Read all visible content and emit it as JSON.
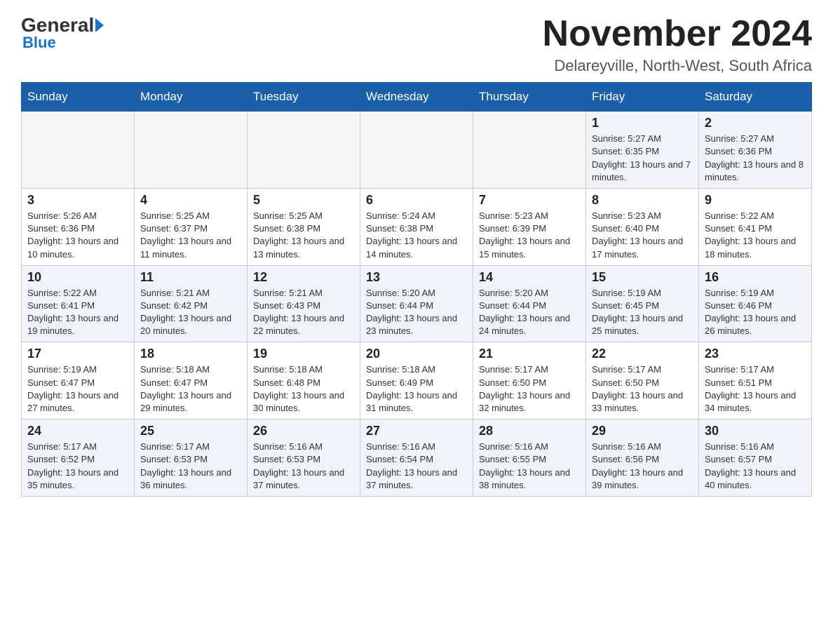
{
  "logo": {
    "general": "General",
    "blue": "Blue"
  },
  "title": "November 2024",
  "location": "Delareyville, North-West, South Africa",
  "days_of_week": [
    "Sunday",
    "Monday",
    "Tuesday",
    "Wednesday",
    "Thursday",
    "Friday",
    "Saturday"
  ],
  "weeks": [
    {
      "days": [
        {
          "num": "",
          "info": ""
        },
        {
          "num": "",
          "info": ""
        },
        {
          "num": "",
          "info": ""
        },
        {
          "num": "",
          "info": ""
        },
        {
          "num": "",
          "info": ""
        },
        {
          "num": "1",
          "info": "Sunrise: 5:27 AM\nSunset: 6:35 PM\nDaylight: 13 hours and 7 minutes."
        },
        {
          "num": "2",
          "info": "Sunrise: 5:27 AM\nSunset: 6:36 PM\nDaylight: 13 hours and 8 minutes."
        }
      ]
    },
    {
      "days": [
        {
          "num": "3",
          "info": "Sunrise: 5:26 AM\nSunset: 6:36 PM\nDaylight: 13 hours and 10 minutes."
        },
        {
          "num": "4",
          "info": "Sunrise: 5:25 AM\nSunset: 6:37 PM\nDaylight: 13 hours and 11 minutes."
        },
        {
          "num": "5",
          "info": "Sunrise: 5:25 AM\nSunset: 6:38 PM\nDaylight: 13 hours and 13 minutes."
        },
        {
          "num": "6",
          "info": "Sunrise: 5:24 AM\nSunset: 6:38 PM\nDaylight: 13 hours and 14 minutes."
        },
        {
          "num": "7",
          "info": "Sunrise: 5:23 AM\nSunset: 6:39 PM\nDaylight: 13 hours and 15 minutes."
        },
        {
          "num": "8",
          "info": "Sunrise: 5:23 AM\nSunset: 6:40 PM\nDaylight: 13 hours and 17 minutes."
        },
        {
          "num": "9",
          "info": "Sunrise: 5:22 AM\nSunset: 6:41 PM\nDaylight: 13 hours and 18 minutes."
        }
      ]
    },
    {
      "days": [
        {
          "num": "10",
          "info": "Sunrise: 5:22 AM\nSunset: 6:41 PM\nDaylight: 13 hours and 19 minutes."
        },
        {
          "num": "11",
          "info": "Sunrise: 5:21 AM\nSunset: 6:42 PM\nDaylight: 13 hours and 20 minutes."
        },
        {
          "num": "12",
          "info": "Sunrise: 5:21 AM\nSunset: 6:43 PM\nDaylight: 13 hours and 22 minutes."
        },
        {
          "num": "13",
          "info": "Sunrise: 5:20 AM\nSunset: 6:44 PM\nDaylight: 13 hours and 23 minutes."
        },
        {
          "num": "14",
          "info": "Sunrise: 5:20 AM\nSunset: 6:44 PM\nDaylight: 13 hours and 24 minutes."
        },
        {
          "num": "15",
          "info": "Sunrise: 5:19 AM\nSunset: 6:45 PM\nDaylight: 13 hours and 25 minutes."
        },
        {
          "num": "16",
          "info": "Sunrise: 5:19 AM\nSunset: 6:46 PM\nDaylight: 13 hours and 26 minutes."
        }
      ]
    },
    {
      "days": [
        {
          "num": "17",
          "info": "Sunrise: 5:19 AM\nSunset: 6:47 PM\nDaylight: 13 hours and 27 minutes."
        },
        {
          "num": "18",
          "info": "Sunrise: 5:18 AM\nSunset: 6:47 PM\nDaylight: 13 hours and 29 minutes."
        },
        {
          "num": "19",
          "info": "Sunrise: 5:18 AM\nSunset: 6:48 PM\nDaylight: 13 hours and 30 minutes."
        },
        {
          "num": "20",
          "info": "Sunrise: 5:18 AM\nSunset: 6:49 PM\nDaylight: 13 hours and 31 minutes."
        },
        {
          "num": "21",
          "info": "Sunrise: 5:17 AM\nSunset: 6:50 PM\nDaylight: 13 hours and 32 minutes."
        },
        {
          "num": "22",
          "info": "Sunrise: 5:17 AM\nSunset: 6:50 PM\nDaylight: 13 hours and 33 minutes."
        },
        {
          "num": "23",
          "info": "Sunrise: 5:17 AM\nSunset: 6:51 PM\nDaylight: 13 hours and 34 minutes."
        }
      ]
    },
    {
      "days": [
        {
          "num": "24",
          "info": "Sunrise: 5:17 AM\nSunset: 6:52 PM\nDaylight: 13 hours and 35 minutes."
        },
        {
          "num": "25",
          "info": "Sunrise: 5:17 AM\nSunset: 6:53 PM\nDaylight: 13 hours and 36 minutes."
        },
        {
          "num": "26",
          "info": "Sunrise: 5:16 AM\nSunset: 6:53 PM\nDaylight: 13 hours and 37 minutes."
        },
        {
          "num": "27",
          "info": "Sunrise: 5:16 AM\nSunset: 6:54 PM\nDaylight: 13 hours and 37 minutes."
        },
        {
          "num": "28",
          "info": "Sunrise: 5:16 AM\nSunset: 6:55 PM\nDaylight: 13 hours and 38 minutes."
        },
        {
          "num": "29",
          "info": "Sunrise: 5:16 AM\nSunset: 6:56 PM\nDaylight: 13 hours and 39 minutes."
        },
        {
          "num": "30",
          "info": "Sunrise: 5:16 AM\nSunset: 6:57 PM\nDaylight: 13 hours and 40 minutes."
        }
      ]
    }
  ]
}
